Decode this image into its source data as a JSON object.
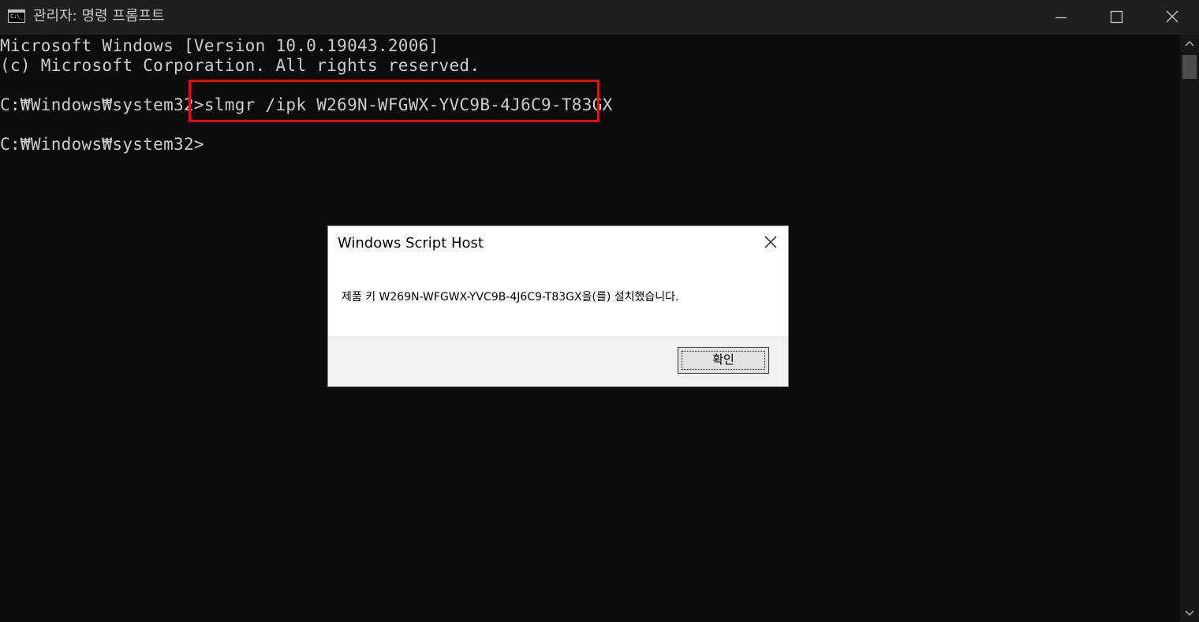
{
  "window": {
    "title": "관리자: 명령 프롬프트",
    "icon": "cmd-icon",
    "icon_text": "C:\\_",
    "controls": [
      "minimize-icon",
      "maximize-icon",
      "close-icon"
    ]
  },
  "console": {
    "lines": [
      "Microsoft Windows [Version 10.0.19043.2006]",
      "(c) Microsoft Corporation. All rights reserved.",
      "C:₩Windows₩system32>slmgr /ipk W269N-WFGWX-YVC9B-4J6C9-T83GX",
      "C:₩Windows₩system32>"
    ],
    "highlight_color": "#ff0000"
  },
  "dialog": {
    "title": "Windows Script Host",
    "message": "제품 키 W269N-WFGWX-YVC9B-4J6C9-T83GX을(를) 설치했습니다.",
    "ok_label": "확인"
  },
  "colors": {
    "console_bg": "#0c0c0c",
    "console_text": "#cccccc",
    "titlebar_bg": "#1f1f1f"
  }
}
